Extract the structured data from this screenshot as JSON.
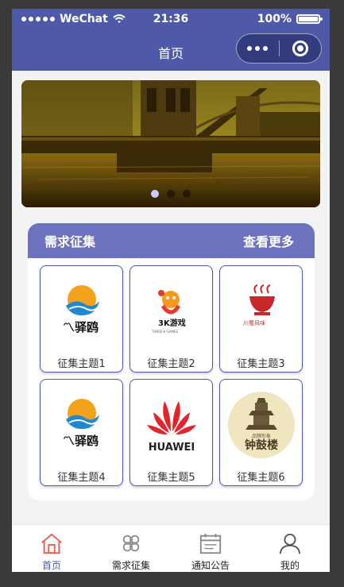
{
  "status_bar": {
    "carrier": "WeChat",
    "time": "21:36",
    "battery": "100%"
  },
  "nav": {
    "title": "首页",
    "more_icon": "more-dots-icon",
    "close_icon": "target-close-icon"
  },
  "banner": {
    "slides": 3,
    "active_index": 0,
    "indicator_active_color": "#c7cbff"
  },
  "section": {
    "title": "需求征集",
    "more_label": "查看更多",
    "header_color": "#6c72bd",
    "items": [
      {
        "label": "征集主题1",
        "logo": "yi-yi-ou-logo"
      },
      {
        "label": "征集主题2",
        "logo": "3k-games-logo"
      },
      {
        "label": "征集主题3",
        "logo": "restaurant-logo"
      },
      {
        "label": "征集主题4",
        "logo": "yi-yi-ou-logo"
      },
      {
        "label": "征集主题5",
        "logo": "huawei-logo"
      },
      {
        "label": "征集主题6",
        "logo": "bell-tower-logo"
      }
    ]
  },
  "tabs": [
    {
      "label": "首页",
      "icon": "home-icon",
      "active": true
    },
    {
      "label": "需求征集",
      "icon": "clover-icon",
      "active": false
    },
    {
      "label": "通知公告",
      "icon": "calendar-icon",
      "active": false
    },
    {
      "label": "我的",
      "icon": "user-icon",
      "active": false
    }
  ],
  "colors": {
    "primary": "#4e5aa8",
    "active_tab_icon": "#e85d4f"
  },
  "logo_text": {
    "yiyiou_cn": "驿鸥",
    "threek_cn": "游戏",
    "threek_en": "THREE-K GAMES",
    "restaurant": "川蜀风味",
    "huawei": "HUAWEI",
    "belltower": "钟鼓楼",
    "belltower_sub": "品牌形象"
  }
}
